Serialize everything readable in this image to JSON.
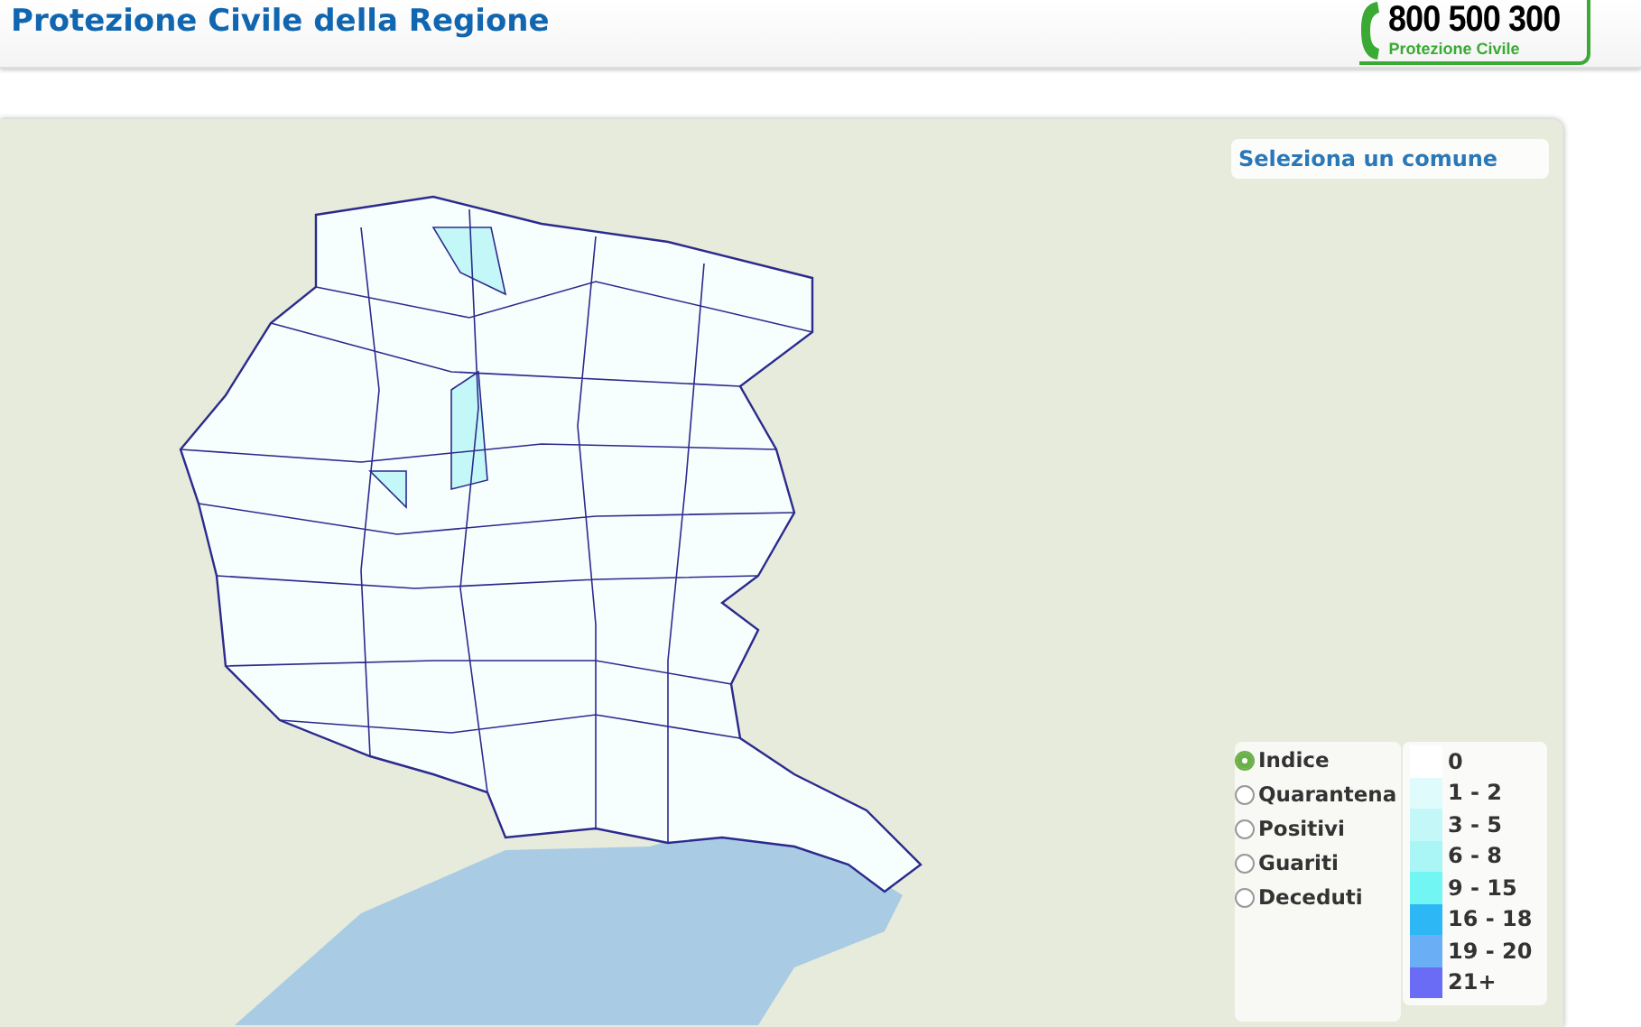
{
  "header": {
    "title": "Protezione Civile della Regione",
    "hotline": {
      "number": "800 500 300",
      "caption": "Protezione Civile"
    }
  },
  "map": {
    "select_label": "Seleziona un comune",
    "metrics": [
      {
        "label": "Indice",
        "selected": true
      },
      {
        "label": "Quarantena",
        "selected": false
      },
      {
        "label": "Positivi",
        "selected": false
      },
      {
        "label": "Guariti",
        "selected": false
      },
      {
        "label": "Deceduti",
        "selected": false
      }
    ],
    "legend": [
      {
        "label": "0",
        "color": "#ffffff"
      },
      {
        "label": "1 - 2",
        "color": "#e0fbfb"
      },
      {
        "label": "3 - 5",
        "color": "#c4f8f8"
      },
      {
        "label": "6 - 8",
        "color": "#aaf6f6"
      },
      {
        "label": "9 - 15",
        "color": "#72f6f4"
      },
      {
        "label": "16 - 18",
        "color": "#2db8f5"
      },
      {
        "label": "19 - 20",
        "color": "#6aaef5"
      },
      {
        "label": "21+",
        "color": "#6b6cf5"
      }
    ]
  }
}
